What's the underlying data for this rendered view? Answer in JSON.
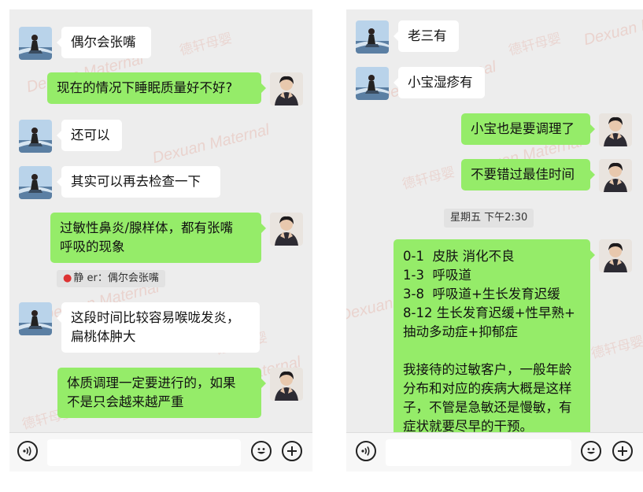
{
  "left": {
    "messages": [
      {
        "text": "偶尔会张嘴"
      },
      {
        "text": "现在的情况下睡眠质量好不好?"
      },
      {
        "text": "还可以"
      },
      {
        "text": "其实可以再去检查一下"
      },
      {
        "text": "过敏性鼻炎/腺样体，都有张嘴\n呼吸的现象"
      },
      {
        "text": "这段时间比较容易喉咙发炎，\n扁桃体肿大"
      },
      {
        "text": "体质调理一定要进行的，如果\n不是只会越来越严重"
      },
      {
        "text": ""
      }
    ],
    "quote": {
      "author": "静 er",
      "text": "静 er：偶尔会张嘴"
    }
  },
  "right": {
    "messages": [
      {
        "text": "老三有"
      },
      {
        "text": "小宝湿疹有"
      },
      {
        "text": "小宝也是要调理了"
      },
      {
        "text": "不要错过最佳时间"
      },
      {
        "text": "0-1  皮肤 消化不良\n1-3  呼吸道\n3-8  呼吸道+生长发育迟缓\n8-12 生长发育迟缓+性早熟+\n抽动多动症+抑郁症\n\n我接待的过敏客户，一般年龄\n分布和对应的疾病大概是这样\n子，不管是急敏还是慢敏，有\n症状就要尽早的干预。"
      }
    ],
    "timestamp": "星期五 下午2:30"
  },
  "watermarks": {
    "en": "Dexuan Maternal",
    "cn": "德轩母婴"
  },
  "icons": {
    "voice": "voice-icon",
    "emoji": "emoji-icon",
    "add": "add-icon",
    "quote": "lips-icon"
  },
  "colors": {
    "incoming": "#ffffff",
    "outgoing": "#95ec69",
    "chat_bg": "#ededed"
  }
}
